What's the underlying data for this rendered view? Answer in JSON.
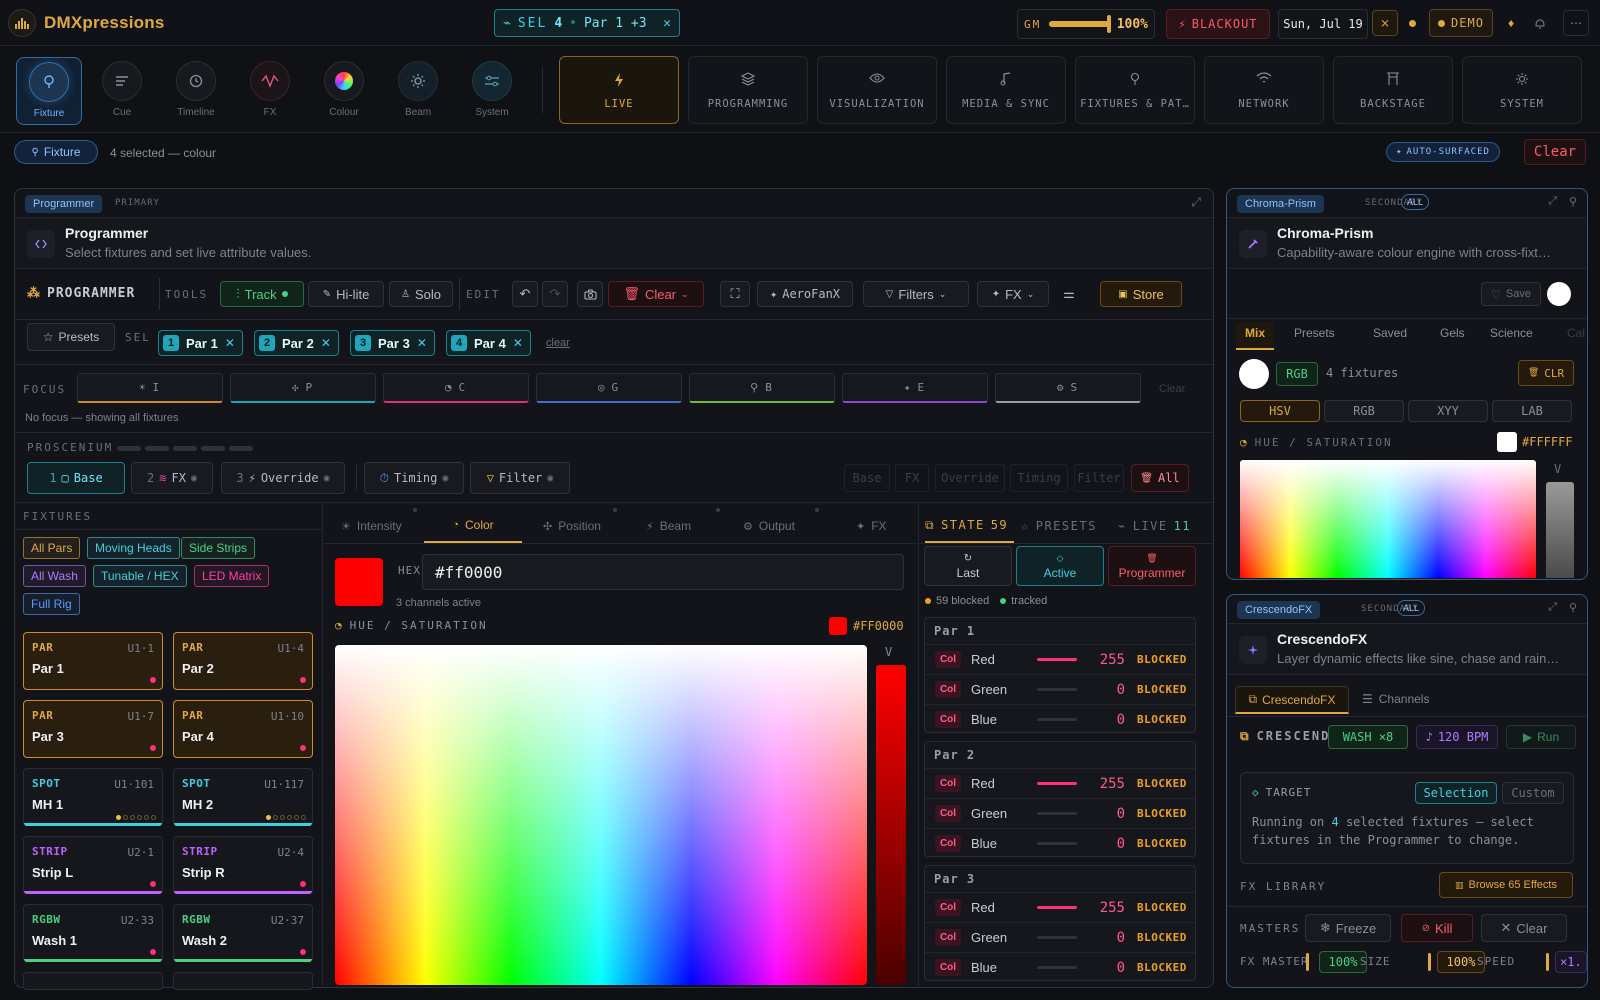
{
  "app": {
    "brand": "DMXpressions",
    "selection_chip": "SEL",
    "selection_count": "4",
    "selection_text": "Par 1 +3",
    "gm_label": "GM",
    "gm_value": "100%",
    "gm_level": 1.0,
    "blackout_label": "BLACKOUT",
    "date": "Sun, Jul 19",
    "demo_label": "DEMO",
    "accent": "#e0a840",
    "cyan": "#3fd0e0",
    "danger": "#ff5a66"
  },
  "tools": [
    {
      "label": "Fixture",
      "icon": "bulb-icon",
      "active": true
    },
    {
      "label": "Cue",
      "icon": "list-icon"
    },
    {
      "label": "Timeline",
      "icon": "clock-icon"
    },
    {
      "label": "FX",
      "icon": "waveform-icon"
    },
    {
      "label": "Colour",
      "icon": "colour-wheel-icon"
    },
    {
      "label": "Beam",
      "icon": "sun-icon"
    },
    {
      "label": "System",
      "icon": "sliders-icon"
    }
  ],
  "sections": [
    {
      "label": "LIVE",
      "icon": "bolt-icon",
      "active": true
    },
    {
      "label": "PROGRAMMING",
      "icon": "layers-icon"
    },
    {
      "label": "VISUALIZATION",
      "icon": "eye-icon"
    },
    {
      "label": "MEDIA & SYNC",
      "icon": "music-icon"
    },
    {
      "label": "FIXTURES & PAT…",
      "icon": "bulb-icon"
    },
    {
      "label": "NETWORK",
      "icon": "wifi-icon"
    },
    {
      "label": "BACKSTAGE",
      "icon": "frame-icon"
    },
    {
      "label": "SYSTEM",
      "icon": "gear-icon"
    }
  ],
  "context": {
    "fixture_chip": "Fixture",
    "summary": "4 selected — colour",
    "auto_surfaced": "AUTO-SURFACED",
    "clear": "Clear"
  },
  "programmer": {
    "tag": "Programmer",
    "role": "PRIMARY",
    "title": "Programmer",
    "description": "Select fixtures and set live attribute values.",
    "heading": "PROGRAMMER",
    "tools_label": "TOOLS",
    "track": "Track",
    "hilite": "Hi-lite",
    "solo": "Solo",
    "edit_label": "EDIT",
    "clear": "Clear",
    "aerofanx": "AeroFanX",
    "filters": "Filters",
    "fx": "FX",
    "store": "Store",
    "presets": "Presets",
    "sel_label": "SEL",
    "selection": [
      {
        "n": "1",
        "name": "Par 1"
      },
      {
        "n": "2",
        "name": "Par 2"
      },
      {
        "n": "3",
        "name": "Par 3"
      },
      {
        "n": "4",
        "name": "Par 4"
      }
    ],
    "sel_clear": "clear",
    "focus_label": "FOCUS",
    "focus": [
      {
        "key": "I",
        "color": "#d08a2a"
      },
      {
        "key": "P",
        "color": "#1fa6b8"
      },
      {
        "key": "C",
        "color": "#e0307a"
      },
      {
        "key": "G",
        "color": "#4a6ad0"
      },
      {
        "key": "B",
        "color": "#7ab83a"
      },
      {
        "key": "E",
        "color": "#8a4ad0"
      },
      {
        "key": "S",
        "color": "#9a9ea6"
      }
    ],
    "focus_clear": "Clear",
    "focus_hint": "No focus — showing all fixtures",
    "proscenium_label": "PROSCENIUM",
    "layers": [
      {
        "n": "1",
        "label": "Base"
      },
      {
        "n": "2",
        "label": "FX"
      },
      {
        "n": "3",
        "label": "Override"
      }
    ],
    "timing": "Timing",
    "filter": "Filter",
    "layer_ghosts": [
      "Base",
      "FX",
      "Override",
      "Timing",
      "Filter"
    ],
    "all": "All"
  },
  "fixtures": {
    "heading": "FIXTURES",
    "groups": [
      {
        "label": "All Pars",
        "color": "#e0a840"
      },
      {
        "label": "Moving Heads",
        "color": "#3fd0e0"
      },
      {
        "label": "Side Strips",
        "color": "#4ad080"
      },
      {
        "label": "All Wash",
        "color": "#b07aff"
      },
      {
        "label": "Tunable / HEX",
        "color": "#3fd0e0"
      },
      {
        "label": "LED Matrix",
        "color": "#ff3fa0"
      },
      {
        "label": "Full Rig",
        "color": "#5a9aff"
      }
    ],
    "cards": [
      {
        "type": "PAR",
        "addr": "U1·1",
        "name": "Par 1",
        "color": "#e0a840",
        "selected": true
      },
      {
        "type": "PAR",
        "addr": "U1·4",
        "name": "Par 2",
        "color": "#e0a840",
        "selected": true
      },
      {
        "type": "PAR",
        "addr": "U1·7",
        "name": "Par 3",
        "color": "#e0a840",
        "selected": true
      },
      {
        "type": "PAR",
        "addr": "U1·10",
        "name": "Par 4",
        "color": "#e0a840",
        "selected": true
      },
      {
        "type": "SPOT",
        "addr": "U1·101",
        "name": "MH 1",
        "color": "#3fd0e0",
        "selected": false
      },
      {
        "type": "SPOT",
        "addr": "U1·117",
        "name": "MH 2",
        "color": "#3fd0e0",
        "selected": false
      },
      {
        "type": "STRIP",
        "addr": "U2·1",
        "name": "Strip L",
        "color": "#c060ff",
        "selected": false
      },
      {
        "type": "STRIP",
        "addr": "U2·4",
        "name": "Strip R",
        "color": "#c060ff",
        "selected": false
      },
      {
        "type": "RGBW",
        "addr": "U2·33",
        "name": "Wash 1",
        "color": "#4ad080",
        "selected": false
      },
      {
        "type": "RGBW",
        "addr": "U2·37",
        "name": "Wash 2",
        "color": "#4ad080",
        "selected": false
      }
    ]
  },
  "attributes": {
    "tabs": [
      "Intensity",
      "Color",
      "Position",
      "Beam",
      "Output",
      "FX"
    ],
    "active_tab": "Color",
    "hex_label": "HEX",
    "hex_value": "#ff0000",
    "channels_active": "3 channels active",
    "hue_label": "HUE / SATURATION",
    "hue_value": "#FF0000",
    "v_label": "V",
    "current_color": "#ff0000"
  },
  "state": {
    "tabs": [
      {
        "label": "STATE",
        "count": "59"
      },
      {
        "label": "PRESETS",
        "count": ""
      },
      {
        "label": "LIVE",
        "count": "11"
      }
    ],
    "buttons": [
      "Last",
      "Active",
      "Programmer"
    ],
    "blocked": "59 blocked",
    "tracked": "tracked",
    "col_tag": "Col",
    "groups": [
      {
        "name": "Par 1",
        "rows": [
          {
            "ch": "Red",
            "val": "255"
          },
          {
            "ch": "Green",
            "val": "0"
          },
          {
            "ch": "Blue",
            "val": "0"
          }
        ]
      },
      {
        "name": "Par 2",
        "rows": [
          {
            "ch": "Red",
            "val": "255"
          },
          {
            "ch": "Green",
            "val": "0"
          },
          {
            "ch": "Blue",
            "val": "0"
          }
        ]
      },
      {
        "name": "Par 3",
        "rows": [
          {
            "ch": "Red",
            "val": "255"
          },
          {
            "ch": "Green",
            "val": "0"
          },
          {
            "ch": "Blue",
            "val": "0"
          }
        ]
      }
    ],
    "status": "BLOCKED"
  },
  "chroma": {
    "tag": "Chroma-Prism",
    "role": "SECONDARY",
    "all": "ALL",
    "title": "Chroma-Prism",
    "description": "Capability-aware colour engine with cross-fixt…",
    "save": "Save",
    "tabs": [
      "Mix",
      "Presets",
      "Saved",
      "Gels",
      "Science",
      "Cal"
    ],
    "rgb_chip": "RGB",
    "fixtures": "4 fixtures",
    "clr": "CLR",
    "modes": [
      "HSV",
      "RGB",
      "XYY",
      "LAB"
    ],
    "hue_label": "HUE / SATURATION",
    "hue_value": "#FFFFFF",
    "v_label": "V"
  },
  "crescendo": {
    "tag": "CrescendoFX",
    "role": "SECONDARY",
    "all": "ALL",
    "title": "CrescendoFX",
    "description": "Layer dynamic effects like sine, chase and rain…",
    "tabs": [
      "CrescendoFX",
      "Channels"
    ],
    "heading": "CRESCENDO",
    "wash_chip": "WASH ×8",
    "bpm": "120 BPM",
    "run": "Run",
    "target_label": "TARGET",
    "selection": "Selection",
    "custom": "Custom",
    "target_text_a": "Running on",
    "target_count": "4",
    "target_text_b": "selected fixtures — select fixtures in the Programmer to change.",
    "library_label": "FX LIBRARY",
    "browse": "Browse 65 Effects",
    "masters_label": "MASTERS",
    "freeze": "Freeze",
    "kill": "Kill",
    "clear": "Clear",
    "fx_master_label": "FX MASTER",
    "fx_master_value": "100%",
    "size_label": "SIZE",
    "size_value": "100%",
    "speed_label": "SPEED",
    "speed_value": "×1."
  }
}
